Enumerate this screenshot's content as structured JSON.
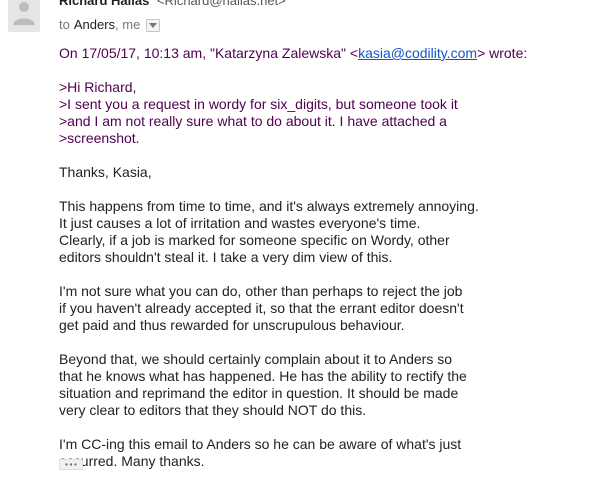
{
  "sender": {
    "name": "Richard Hallas",
    "email": "<Richard@hallas.net>"
  },
  "recipients": {
    "prefix": "to",
    "primary": "Anders",
    "rest": ", me"
  },
  "message": {
    "quote_header": {
      "before": "On 17/05/17, 10:13 am, \"Katarzyna Zalewska\" <",
      "email": "kasia@codility.com",
      "after": "> wrote:"
    },
    "quoted_lines": [
      ">Hi Richard,",
      ">I sent you a request in wordy for six_digits, but someone took it",
      ">and I am not really sure what to do about it. I have attached a",
      ">screenshot."
    ],
    "paragraphs": [
      [
        "Thanks, Kasia,"
      ],
      [
        "This happens from time to time, and it's always extremely annoying.",
        "It just causes a lot of irritation and wastes everyone's time.",
        "Clearly, if a job is marked for someone specific on Wordy, other",
        "editors shouldn't steal it. I take a very dim view of this."
      ],
      [
        "I'm not sure what you can do, other than perhaps to reject the job",
        "if you haven't already accepted it, so that the errant editor doesn't",
        "get paid and thus rewarded for unscrupulous behaviour."
      ],
      [
        "Beyond that, we should certainly complain about it to Anders so",
        "that he knows what has happened. He has the ability to rectify the",
        "situation and reprimand the editor in question. It should be made",
        "very clear to editors that they should NOT do this."
      ],
      [
        "I'm CC-ing this email to Anders so he can be aware of what's just",
        "occurred. Many thanks."
      ]
    ]
  },
  "icons": {
    "avatar": "person-silhouette-icon",
    "details_toggle": "chevron-down-icon",
    "trimmed_content": "ellipsis-icon"
  },
  "colors": {
    "quoted_text": "#500050",
    "link": "#1155cc",
    "body_text": "#222222"
  }
}
